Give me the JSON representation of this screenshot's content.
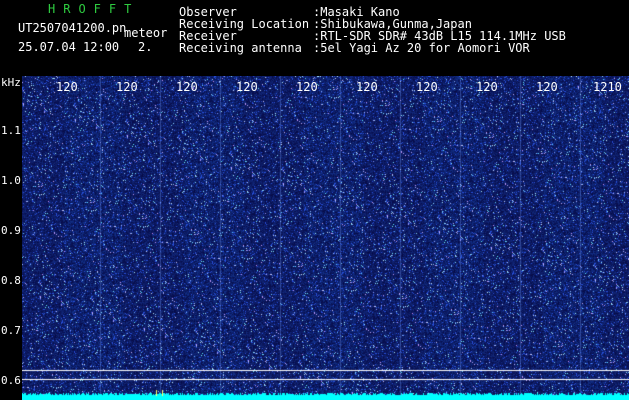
{
  "header": {
    "logo": "HROFFT",
    "filename": "UT2507041200.pn",
    "tag": "meteor",
    "datetime": "25.07.04 12:00",
    "count": "2.",
    "fields": [
      {
        "label": "Observer",
        "value": ":Masaki Kano"
      },
      {
        "label": "Receiving Location",
        "value": ":Shibukawa,Gunma,Japan"
      },
      {
        "label": "Receiver",
        "value": ":RTL-SDR SDR# 43dB L15 114.1MHz USB"
      },
      {
        "label": "Receiving antenna",
        "value": ":5el Yagi Az 20 for Aomori VOR"
      }
    ]
  },
  "spectrogram": {
    "unit": "kHz",
    "y_ticks": [
      "1.1",
      "1.0",
      "0.9",
      "0.8",
      "0.7",
      "0.6"
    ],
    "x_ticks": [
      "120",
      "120",
      "120",
      "120",
      "120",
      "120",
      "120",
      "120",
      "120",
      "1210"
    ],
    "colors": {
      "background": "#08106e",
      "noise": "#3a62ff",
      "baseline": "#00ffff",
      "marker": "#ffffff"
    }
  }
}
